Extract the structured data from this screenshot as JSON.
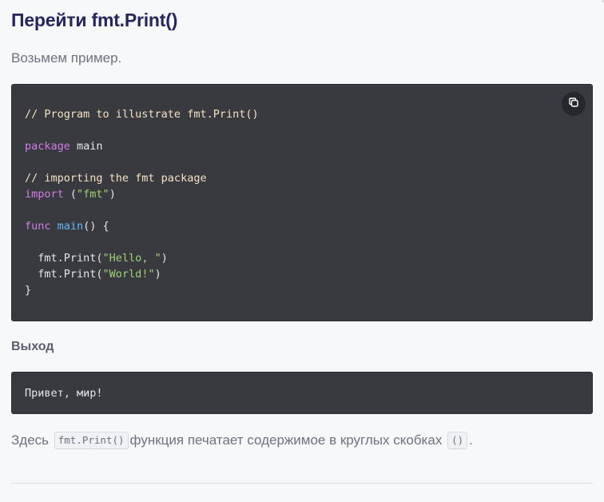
{
  "heading": "Перейти fmt.Print()",
  "intro": "Возьмем пример.",
  "code_block": {
    "copy_icon": "copy-icon",
    "lines": {
      "l1": "// Program to illustrate fmt.Print()",
      "l3_kw": "package",
      "l3_rest": " main",
      "l5": "// importing the fmt package",
      "l6_kw": "import",
      "l6_open": " (",
      "l6_str": "\"fmt\"",
      "l6_close": ")",
      "l8_kw": "func",
      "l8_sp": " ",
      "l8_fn": "main",
      "l8_rest": "() {",
      "l10_pre": "  fmt.Print(",
      "l10_str": "\"Hello, \"",
      "l10_post": ")",
      "l11_pre": "  fmt.Print(",
      "l11_str": "\"World!\"",
      "l11_post": ")",
      "l12": "}"
    }
  },
  "output": {
    "heading": "Выход",
    "text": "Привет, мир!"
  },
  "explanation": {
    "before": "Здесь",
    "code1": "fmt.Print()",
    "middle": "функция печатает содержимое в круглых скобках",
    "code2": "()",
    "after": "."
  },
  "colors": {
    "heading": "#25265e",
    "code_bg": "#383a40",
    "comment": "#f4e1c1",
    "keyword": "#d07ee6",
    "string": "#9fd26f",
    "function": "#66b8f0"
  }
}
